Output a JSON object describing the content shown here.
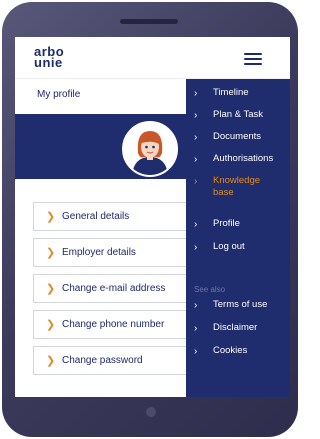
{
  "app": {
    "logo_line1": "arbo",
    "logo_line2": "unie"
  },
  "header": {
    "menu_icon": "hamburger-menu-icon"
  },
  "profile": {
    "label": "My profile"
  },
  "profile_links": [
    {
      "label": "General details",
      "icon": "chevron-right-icon"
    },
    {
      "label": "Employer details",
      "icon": "chevron-right-icon"
    },
    {
      "label": "Change e-mail address",
      "icon": "chevron-right-icon"
    },
    {
      "label": "Change phone number",
      "icon": "chevron-right-icon"
    },
    {
      "label": "Change password",
      "icon": "chevron-right-icon"
    }
  ],
  "menu": {
    "items": [
      {
        "label": "Timeline"
      },
      {
        "label": "Plan & Task"
      },
      {
        "label": "Documents"
      },
      {
        "label": "Authorisations"
      },
      {
        "label": "Knowledge base",
        "active": true
      },
      {
        "label": "Profile"
      },
      {
        "label": "Log out"
      }
    ],
    "see_also_label": "See also",
    "see_also_items": [
      {
        "label": "Terms of use"
      },
      {
        "label": "Disclaimer"
      },
      {
        "label": "Cookies"
      }
    ]
  },
  "colors": {
    "navy": "#1f2c6e",
    "accent_orange": "#e08a2a",
    "device_frame": "#3d3b5c"
  }
}
